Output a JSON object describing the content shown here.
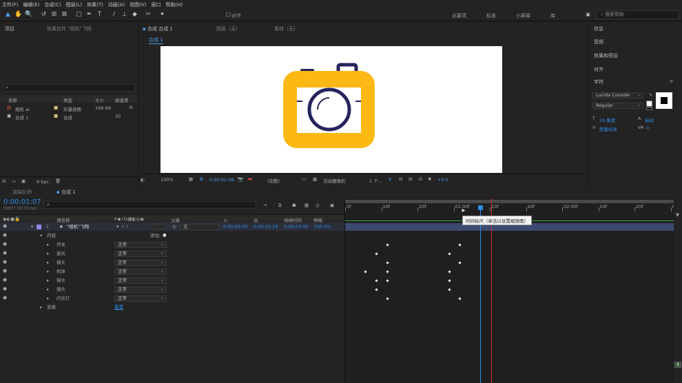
{
  "menu": [
    "文件(F)",
    "编辑(E)",
    "合成(C)",
    "图层(L)",
    "效果(T)",
    "动画(A)",
    "视图(V)",
    "窗口",
    "帮助(H)"
  ],
  "toolbar": {
    "align_label": "对齐",
    "workspaces": [
      "必要项",
      "标准",
      "小屏幕",
      "库"
    ],
    "search_placeholder": "搜索帮助"
  },
  "project": {
    "tab": "项目",
    "effects_tab": "效果控件 \"相机\"飞翔",
    "search_icon": "search-icon",
    "columns": [
      "名称",
      "类型",
      "大小",
      "帧速率"
    ],
    "items": [
      {
        "name": "相机.ai",
        "type": "矢量插图",
        "size": "168 KB",
        "fps": ""
      },
      {
        "name": "合成 1",
        "type": "合成",
        "size": "",
        "fps": "30"
      }
    ],
    "bpc": "8 bpc"
  },
  "comp_panel": {
    "tab": "合成 合成 1",
    "layer_tab": "图层（无）",
    "footage_tab": "素材（无）",
    "breadcrumb": "合成 1",
    "zoom": "100%",
    "timecode": "0:00:01:08",
    "resolution": "(完整)",
    "camera": "活动摄像机",
    "views": "1 个...",
    "exposure": "+0.0"
  },
  "right_panel": {
    "items": [
      "信息",
      "音频",
      "效果和预设",
      "对齐"
    ],
    "character": "字符",
    "font": "Lucida Console",
    "style": "Regular",
    "size": "29 像素",
    "leading": "自动",
    "tracking": "0",
    "kerning": "度量标准"
  },
  "timeline": {
    "tab_render": "渲染队列",
    "tab_comp": "合成 1",
    "timecode": "0:00:01:07",
    "fps_info": "00037 (30.00 fps)",
    "col_source": "源名称",
    "col_parent": "父级",
    "col_in": "入",
    "col_out": "出",
    "col_duration": "持续时间",
    "col_stretch": "伸缩",
    "layer": {
      "num": "1",
      "name": "\"相机\"飞翔",
      "parent": "无",
      "in": "0:00:00:00",
      "out": "0:00:02:29",
      "duration": "0:00:03:00",
      "stretch": "100.0%"
    },
    "content_label": "内容",
    "add_label": "添加:",
    "transform_label": "变换",
    "reset_label": "重置",
    "groups": [
      {
        "name": "开关",
        "mode": "正常"
      },
      {
        "name": "遮光",
        "mode": "正常"
      },
      {
        "name": "镜头",
        "mode": "正常"
      },
      {
        "name": "机体",
        "mode": "正常"
      },
      {
        "name": "镜头",
        "mode": "正常"
      },
      {
        "name": "镜头",
        "mode": "正常"
      },
      {
        "name": "闪光灯",
        "mode": "正常"
      }
    ],
    "ruler": [
      "0f",
      "10f",
      "20f",
      "01:00f",
      "10f",
      "20f",
      "02:00f",
      "10f",
      "20f",
      "03:0"
    ],
    "tooltip": "时间标尺（单击以设置缩放图）"
  },
  "colors": {
    "accent": "#2d8ceb",
    "camera_body": "#fdb913",
    "camera_lens": "#25245e"
  }
}
